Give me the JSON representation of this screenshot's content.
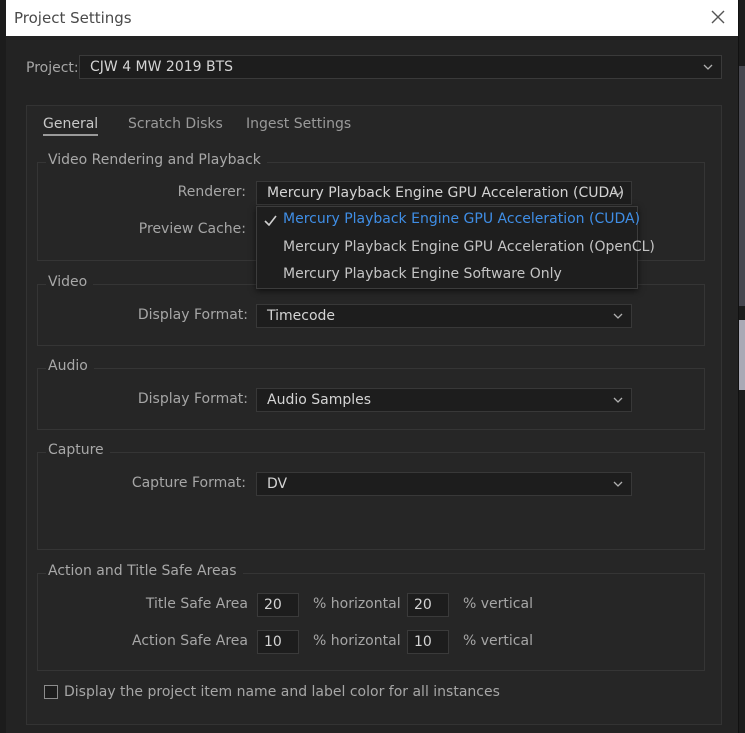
{
  "window": {
    "title": "Project Settings"
  },
  "project": {
    "label": "Project:",
    "value": "CJW 4 MW 2019 BTS"
  },
  "tabs": [
    {
      "label": "General"
    },
    {
      "label": "Scratch Disks"
    },
    {
      "label": "Ingest Settings"
    }
  ],
  "video_rendering": {
    "title": "Video Rendering and Playback",
    "renderer_label": "Renderer:",
    "renderer_value": "Mercury Playback Engine GPU Acceleration (CUDA)",
    "preview_cache_label": "Preview Cache:",
    "renderer_options": [
      "Mercury Playback Engine GPU Acceleration (CUDA)",
      "Mercury Playback Engine GPU Acceleration (OpenCL)",
      "Mercury Playback Engine Software Only"
    ]
  },
  "video": {
    "title": "Video",
    "display_format_label": "Display Format:",
    "display_format_value": "Timecode"
  },
  "audio": {
    "title": "Audio",
    "display_format_label": "Display Format:",
    "display_format_value": "Audio Samples"
  },
  "capture": {
    "title": "Capture",
    "capture_format_label": "Capture Format:",
    "capture_format_value": "DV"
  },
  "safe_areas": {
    "title": "Action and Title Safe Areas",
    "title_safe_label": "Title Safe Area",
    "action_safe_label": "Action Safe Area",
    "horizontal_label": "% horizontal",
    "vertical_label": "% vertical",
    "title_safe_h": "20",
    "title_safe_v": "20",
    "action_safe_h": "10",
    "action_safe_v": "10"
  },
  "display_item_name": {
    "label": "Display the project item name and label color for all instances",
    "checked": false
  },
  "colors": {
    "accent": "#3f8ee6",
    "panel": "#262626",
    "field": "#1d1d1d"
  },
  "icons": {
    "close": "close-icon",
    "chevron": "chevron-down-icon",
    "check": "check-icon"
  }
}
